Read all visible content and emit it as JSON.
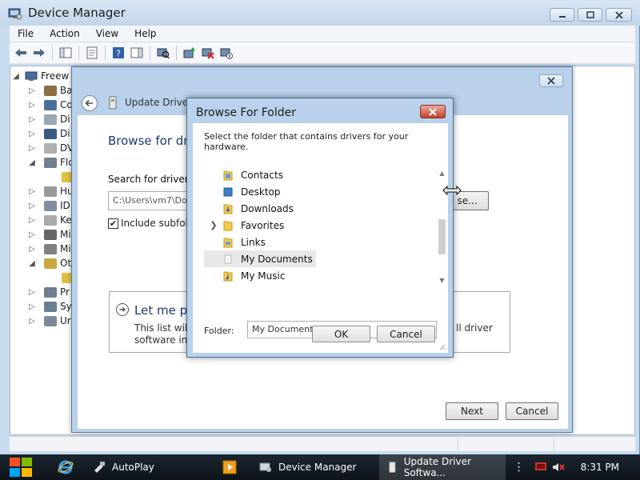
{
  "device_manager": {
    "title": "Device Manager",
    "menu": [
      "File",
      "Action",
      "View",
      "Help"
    ],
    "tree": {
      "root": "Freew",
      "nodes": [
        {
          "label": "Ba",
          "expanded": false
        },
        {
          "label": "Co",
          "expanded": false
        },
        {
          "label": "Di",
          "expanded": false
        },
        {
          "label": "Di",
          "expanded": false
        },
        {
          "label": "DV",
          "expanded": false
        },
        {
          "label": "Flo",
          "expanded": true
        },
        {
          "label": "Hu",
          "expanded": false
        },
        {
          "label": "ID",
          "expanded": false
        },
        {
          "label": "Ke",
          "expanded": false
        },
        {
          "label": "Mi",
          "expanded": false
        },
        {
          "label": "Mi",
          "expanded": false
        },
        {
          "label": "Ot",
          "expanded": true
        },
        {
          "label": "Pr",
          "expanded": false
        },
        {
          "label": "Sy",
          "expanded": false
        },
        {
          "label": "Ur",
          "expanded": false
        }
      ]
    }
  },
  "wizard": {
    "title": "Update Driver S",
    "heading": "Browse for dri",
    "search_label": "Search for driver so",
    "path_value": "C:\\Users\\vm7\\Do",
    "browse_label": "se...",
    "include_subfolders_label": "Include subfold",
    "include_subfolders_checked": true,
    "option": {
      "title": "Let me pi",
      "text_line1": "This list will s",
      "text_line2": "software in t",
      "text_right": "ll driver"
    },
    "next_label": "Next",
    "cancel_label": "Cancel"
  },
  "browse_for_folder": {
    "title": "Browse For Folder",
    "description": "Select the folder that contains drivers for your hardware.",
    "items": [
      {
        "label": "Contacts",
        "expandable": false,
        "selected": false
      },
      {
        "label": "Desktop",
        "expandable": false,
        "selected": false
      },
      {
        "label": "Downloads",
        "expandable": false,
        "selected": false
      },
      {
        "label": "Favorites",
        "expandable": true,
        "selected": false
      },
      {
        "label": "Links",
        "expandable": false,
        "selected": false
      },
      {
        "label": "My Documents",
        "expandable": false,
        "selected": true
      },
      {
        "label": "My Music",
        "expandable": false,
        "selected": false
      }
    ],
    "folder_label": "Folder:",
    "folder_value": "My Documents",
    "ok_label": "OK",
    "cancel_label": "Cancel"
  },
  "taskbar": {
    "items": [
      {
        "label": "AutoPlay"
      },
      {
        "label": "Device Manager"
      },
      {
        "label": "Update Driver Softwa..."
      }
    ],
    "clock": "8:31 PM"
  },
  "colors": {
    "wizard_heading": "#1e3a6e",
    "dialog_frame": "#b9d1ea",
    "close_button": "#c4402c",
    "taskbar": "#141c24"
  }
}
